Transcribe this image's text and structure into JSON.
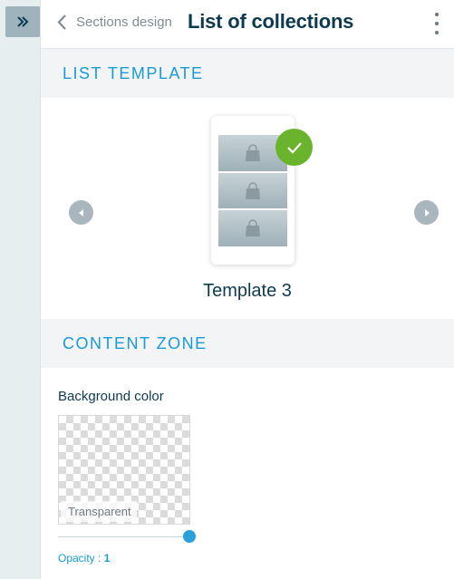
{
  "header": {
    "back_label": "Sections design",
    "title": "List of collections"
  },
  "sections": {
    "list_template": "LIST TEMPLATE",
    "content_zone": "CONTENT ZONE"
  },
  "template": {
    "name": "Template 3",
    "selected": true
  },
  "content": {
    "background_label": "Background color",
    "swatch_value": "Transparent",
    "opacity_label": "Opacity :",
    "opacity_value": "1"
  },
  "colors": {
    "accent": "#1a9ad6",
    "title": "#0e3a4f",
    "check": "#6ab42d"
  }
}
